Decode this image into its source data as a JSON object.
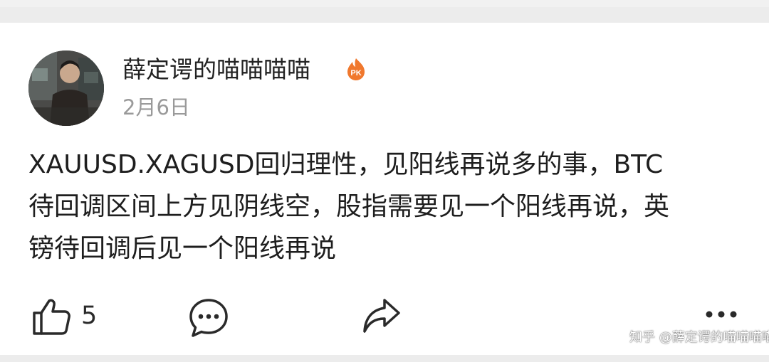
{
  "post": {
    "author": "薛定谔的喵喵喵喵",
    "date": "2月6日",
    "text_lines": [
      "XAUUSD.XAGUSD回归理性，见阳线再说多的事，BTC",
      "待回调区间上方见阴线空，股指需要见一个阳线再说，英",
      "镑待回调后见一个阳线再说"
    ]
  },
  "badge": {
    "label": "PK",
    "color": "#f0782d"
  },
  "actions": {
    "like_count": "5",
    "icons": [
      "thumbs-up-icon",
      "comment-icon",
      "share-icon",
      "more-icon"
    ]
  },
  "watermark": "知乎 @薛定谔的喵喵喵喵",
  "colors": {
    "text": "#1e1e1e",
    "muted": "#9a9a9a",
    "icon": "#2a2a2a",
    "band": "#ececec"
  }
}
